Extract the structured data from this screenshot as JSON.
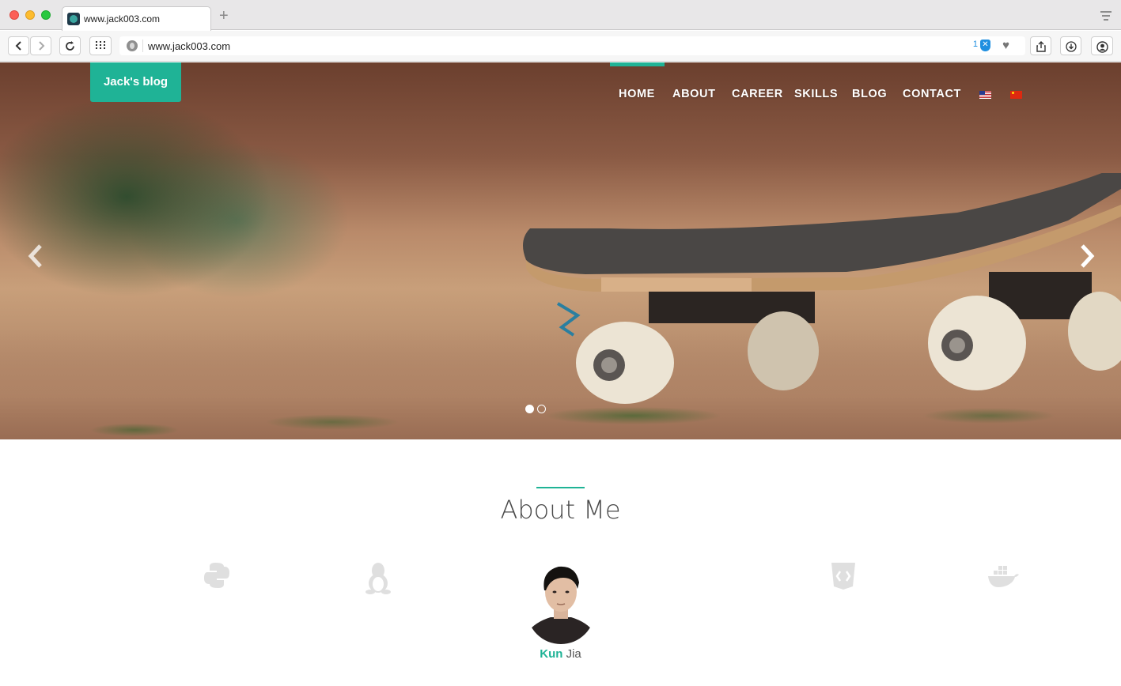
{
  "browser": {
    "tab_title": "www.jack003.com",
    "new_tab_label": "+",
    "url": "www.jack003.com",
    "extension_badge_count": "1"
  },
  "site": {
    "brand": "Jack's blog",
    "nav": [
      {
        "label": "HOME",
        "active": true
      },
      {
        "label": "ABOUT",
        "active": false
      },
      {
        "label": "CAREER",
        "active": false
      },
      {
        "label": "SKILLS",
        "active": false
      },
      {
        "label": "BLOG",
        "active": false
      },
      {
        "label": "CONTACT",
        "active": false
      }
    ],
    "languages": [
      "us-flag-icon",
      "cn-flag-icon"
    ],
    "accent_color": "#1fb396"
  },
  "carousel": {
    "slide_count": 2,
    "active_slide": 1
  },
  "about": {
    "title": "About Me",
    "skill_icons": [
      "python-icon",
      "linux-icon",
      "html5-icon",
      "docker-icon"
    ],
    "name_first": "Kun",
    "name_last": "Jia"
  }
}
